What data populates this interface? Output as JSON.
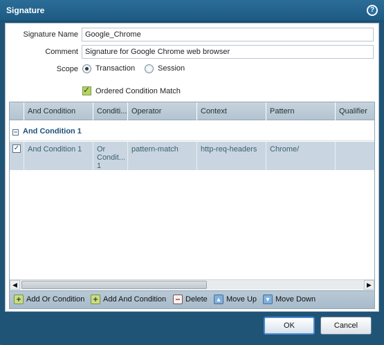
{
  "dialog": {
    "title": "Signature",
    "help_icon": "help-icon"
  },
  "form": {
    "signature_name_label": "Signature Name",
    "signature_name_value": "Google_Chrome",
    "comment_label": "Comment",
    "comment_value": "Signature for Google Chrome web browser",
    "scope_label": "Scope",
    "scope_options": [
      "Transaction",
      "Session"
    ],
    "scope_selected": "Transaction",
    "ordered_match_label": "Ordered Condition Match",
    "ordered_match_checked": true
  },
  "grid": {
    "columns": [
      "And Condition",
      "Conditi...",
      "Operator",
      "Context",
      "Pattern",
      "Qualifier"
    ],
    "group_label": "And Condition 1",
    "rows": [
      {
        "checked": true,
        "and_condition": "And Condition 1",
        "condition": "Or Condit... 1",
        "operator": "pattern-match",
        "context": "http-req-headers",
        "pattern": "Chrome/",
        "qualifier": ""
      }
    ]
  },
  "toolbar": {
    "add_or_condition": "Add Or Condition",
    "add_and_condition": "Add And Condition",
    "delete": "Delete",
    "move_up": "Move Up",
    "move_down": "Move Down"
  },
  "footer": {
    "ok": "OK",
    "cancel": "Cancel"
  }
}
